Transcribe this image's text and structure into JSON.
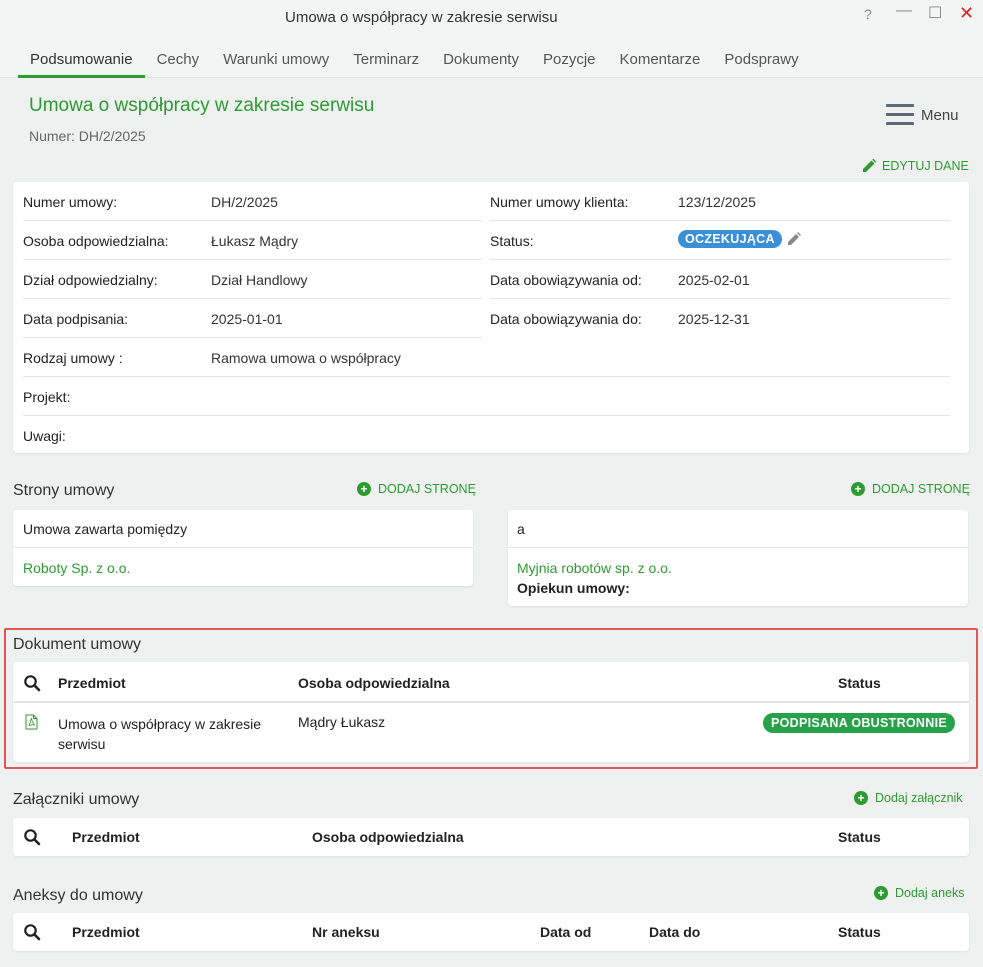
{
  "window": {
    "title": "Umowa o współpracy w zakresie serwisu",
    "help": "?",
    "minimize": "—",
    "maximize": "☐",
    "close": "✕"
  },
  "tabs": [
    "Podsumowanie",
    "Cechy",
    "Warunki umowy",
    "Terminarz",
    "Dokumenty",
    "Pozycje",
    "Komentarze",
    "Podsprawy"
  ],
  "header": {
    "title": "Umowa o współpracy w zakresie serwisu",
    "number": "Numer: DH/2/2025",
    "menu_label": "Menu",
    "edit_label": "EDYTUJ DANE"
  },
  "details": {
    "left": [
      {
        "label": "Numer umowy:",
        "value": "DH/2/2025"
      },
      {
        "label": "Osoba odpowiedzialna:",
        "value": "Łukasz Mądry"
      },
      {
        "label": "Dział odpowiedzialny:",
        "value": "Dział Handlowy"
      },
      {
        "label": "Data podpisania:",
        "value": "2025-01-01"
      },
      {
        "label": "Rodzaj umowy :",
        "value": "Ramowa umowa o współpracy"
      }
    ],
    "right": [
      {
        "label": "Numer umowy klienta:",
        "value": "123/12/2025"
      },
      {
        "label": "Status:",
        "value": "OCZEKUJĄCA"
      },
      {
        "label": "Data obowiązywania od:",
        "value": "2025-02-01"
      },
      {
        "label": "Data obowiązywania do:",
        "value": "2025-12-31"
      }
    ],
    "full": [
      {
        "label": "Projekt:",
        "value": ""
      },
      {
        "label": "Uwagi:",
        "value": ""
      }
    ]
  },
  "parties": {
    "title": "Strony umowy",
    "add_label_left": "DODAJ STRONĘ",
    "add_label_right": "DODAJ STRONĘ",
    "left_header": "Umowa zawarta pomiędzy",
    "left_party": "Roboty Sp. z o.o.",
    "right_header": "a",
    "right_party": "Myjnia robotów sp. z o.o.",
    "right_guardian": "Opiekun umowy:"
  },
  "document": {
    "title": "Dokument umowy",
    "columns": [
      "Przedmiot",
      "Osoba odpowiedzialna",
      "Status"
    ],
    "row": {
      "subject_line1": "Umowa o współpracy w zakresie",
      "subject_line2": "serwisu",
      "person": "Mądry Łukasz",
      "status": "PODPISANA OBUSTRONNIE"
    }
  },
  "attachments": {
    "title": "Załączniki umowy",
    "add_label": "Dodaj załącznik",
    "columns": [
      "Przedmiot",
      "Osoba odpowiedzialna",
      "Status"
    ]
  },
  "annexes": {
    "title": "Aneksy do umowy",
    "add_label": "Dodaj aneks",
    "columns": [
      "Przedmiot",
      "Nr aneksu",
      "Data od",
      "Data do",
      "Status"
    ]
  },
  "colors": {
    "accent": "#2e9a32",
    "status_pending": "#3a8fd6",
    "status_signed": "#27a24a",
    "highlight": "#e05555"
  }
}
